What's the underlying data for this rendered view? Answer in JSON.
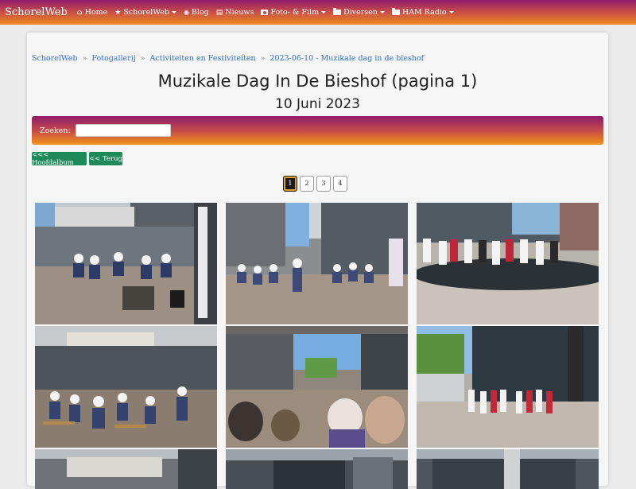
{
  "navbar": {
    "brand": "SchorelWeb",
    "items": [
      {
        "label": "Home",
        "icon": "home-icon",
        "dropdown": false
      },
      {
        "label": "SchorelWeb",
        "icon": "star-icon",
        "dropdown": true
      },
      {
        "label": "Blog",
        "icon": "rss-icon",
        "dropdown": false
      },
      {
        "label": "Nieuws",
        "icon": "newspaper-icon",
        "dropdown": false
      },
      {
        "label": "Foto- & Film",
        "icon": "camera-icon",
        "dropdown": true
      },
      {
        "label": "Diversen",
        "icon": "folder-icon",
        "dropdown": true
      },
      {
        "label": "HAM Radio",
        "icon": "folder-icon",
        "dropdown": true
      }
    ]
  },
  "breadcrumb": [
    "SchorelWeb",
    "Fotogallerij",
    "Activiteiten en Festiviteiten",
    "2023-06-10 - Muzikale dag in de bieshof"
  ],
  "breadcrumb_separator": "»",
  "page": {
    "title": "Muzikale Dag In De Bieshof (pagina 1)",
    "subtitle": "10 Juni 2023"
  },
  "search": {
    "label": "Zoeken:",
    "value": ""
  },
  "buttons": {
    "main_album": "<<< Hoofdalbum",
    "back": "<< Terug"
  },
  "pagination": {
    "pages": [
      "1",
      "2",
      "3",
      "4"
    ],
    "current": "1"
  },
  "colors": {
    "nav_gradient": [
      "#8e1c6c",
      "#f08a1e"
    ],
    "button_green": "#1e8a5a",
    "link_blue": "#2a6fd6"
  },
  "gallery": {
    "photos": [
      {
        "name": "photo-1",
        "scene": "band-playing-in-shopping-street"
      },
      {
        "name": "photo-2",
        "scene": "audience-seated-street"
      },
      {
        "name": "photo-3",
        "scene": "choir-standing-on-square"
      },
      {
        "name": "photo-4",
        "scene": "audience-under-arcade"
      },
      {
        "name": "photo-5",
        "scene": "crowd-closeup-street"
      },
      {
        "name": "photo-6",
        "scene": "choir-in-front-of-building"
      },
      {
        "name": "photo-7",
        "scene": "arcade-partial"
      },
      {
        "name": "photo-8",
        "scene": "arcade-partial"
      },
      {
        "name": "photo-9",
        "scene": "arcade-partial"
      }
    ]
  }
}
